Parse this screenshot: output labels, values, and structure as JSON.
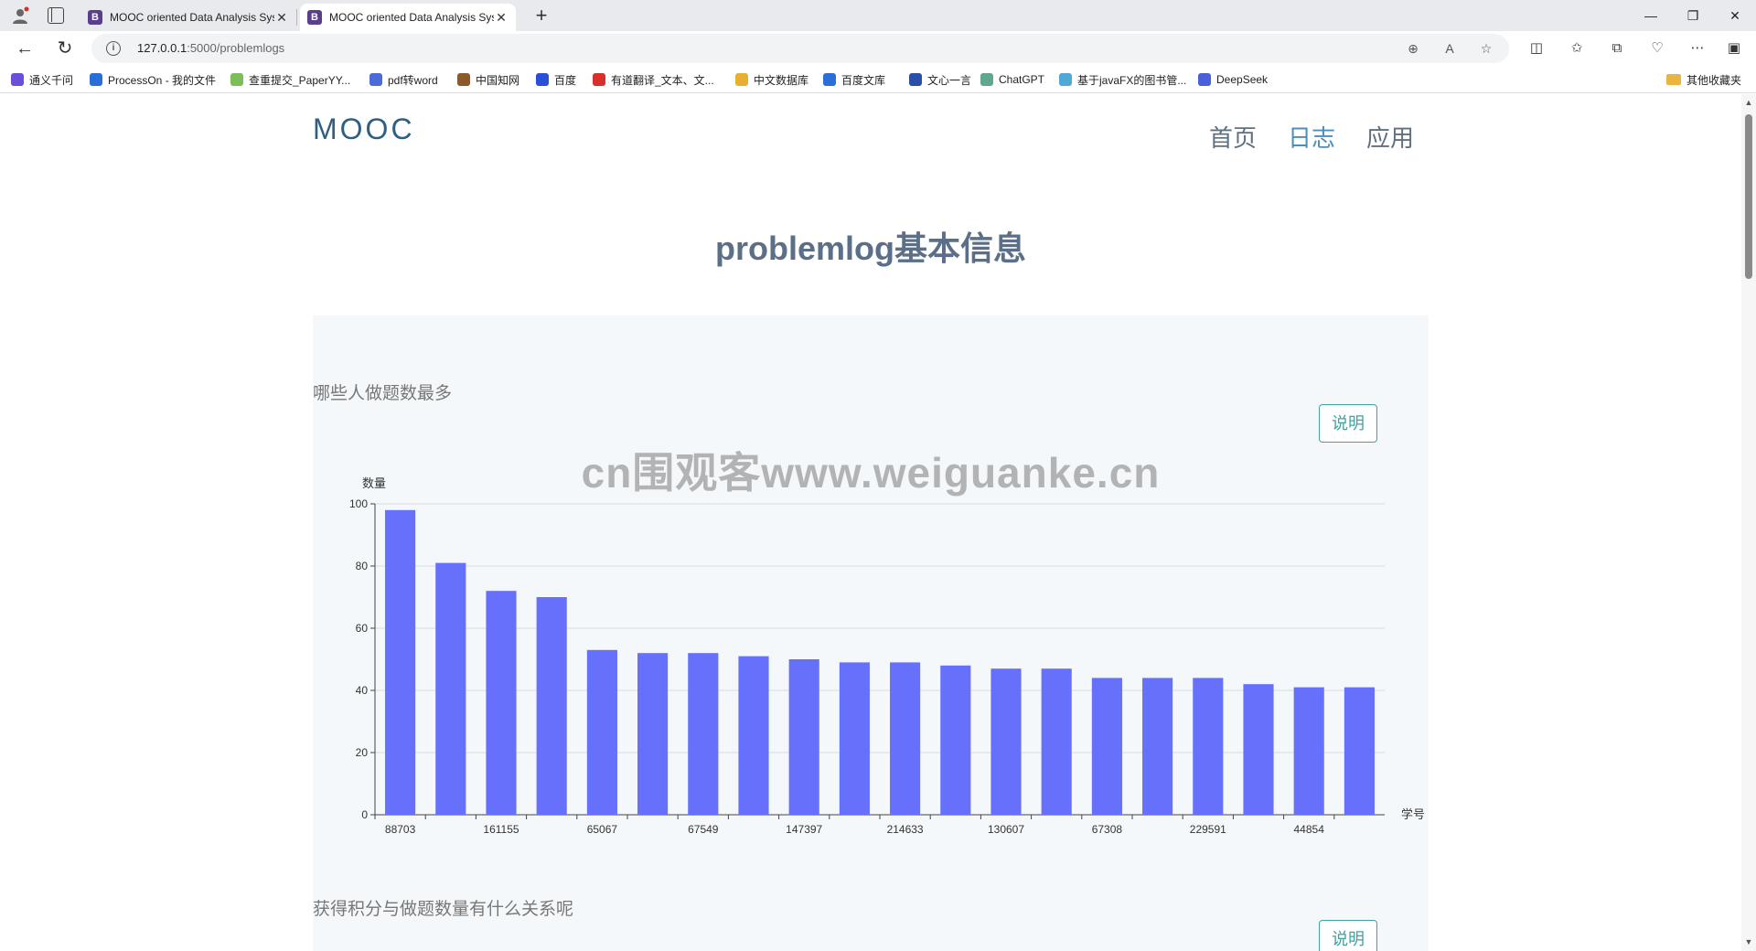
{
  "browser": {
    "tabs": [
      {
        "title": "MOOC oriented Data Analysis Sys",
        "icon": "B"
      },
      {
        "title": "MOOC oriented Data Analysis Sys",
        "icon": "B"
      }
    ],
    "url_host": "127.0.0.1",
    "url_path": ":5000/problemlogs",
    "bookmarks": [
      {
        "label": "通义千问",
        "color": "#6b4fd8"
      },
      {
        "label": "ProcessOn - 我的文件",
        "color": "#2a6fd8"
      },
      {
        "label": "查重提交_PaperYY...",
        "color": "#7cbf5a"
      },
      {
        "label": "pdf转word",
        "color": "#4a6bd8"
      },
      {
        "label": "中国知网",
        "color": "#8c5a2a"
      },
      {
        "label": "百度",
        "color": "#2a4fd8"
      },
      {
        "label": "有道翻译_文本、文...",
        "color": "#d8302a"
      },
      {
        "label": "中文数据库",
        "color": "#e8b030"
      },
      {
        "label": "百度文库",
        "color": "#2a6fd8"
      },
      {
        "label": "文心一言",
        "color": "#2a4fa8"
      },
      {
        "label": "ChatGPT",
        "color": "#5fa88f"
      },
      {
        "label": "基于javaFX的图书管...",
        "color": "#4fa8d8"
      },
      {
        "label": "DeepSeek",
        "color": "#4a5fd8"
      }
    ],
    "other_bookmarks": "其他收藏夹"
  },
  "site": {
    "brand": "MOOC",
    "nav": [
      "首页",
      "日志",
      "应用"
    ],
    "page_title": "problemlog基本信息",
    "watermark": "cn围观客www.weiguanke.cn",
    "sections": [
      {
        "title": "哪些人做题数最多",
        "button": "说明"
      },
      {
        "title": "获得积分与做题数量有什么关系呢",
        "button": "说明"
      }
    ]
  },
  "colors": {
    "bar": "#6670fa",
    "accent": "#3fa3a0"
  },
  "chart_data": {
    "type": "bar",
    "xlabel": "学号",
    "ylabel": "数量",
    "ylim": [
      0,
      100
    ],
    "yticks": [
      0,
      20,
      40,
      60,
      80,
      100
    ],
    "grid": true,
    "categories": [
      "88703",
      "",
      "161155",
      "",
      "65067",
      "",
      "67549",
      "",
      "147397",
      "",
      "214633",
      "",
      "130607",
      "",
      "67308",
      "",
      "229591",
      "",
      "44854",
      ""
    ],
    "values": [
      98,
      81,
      72,
      70,
      53,
      52,
      52,
      51,
      50,
      49,
      49,
      48,
      47,
      47,
      44,
      44,
      44,
      42,
      41,
      41
    ]
  }
}
